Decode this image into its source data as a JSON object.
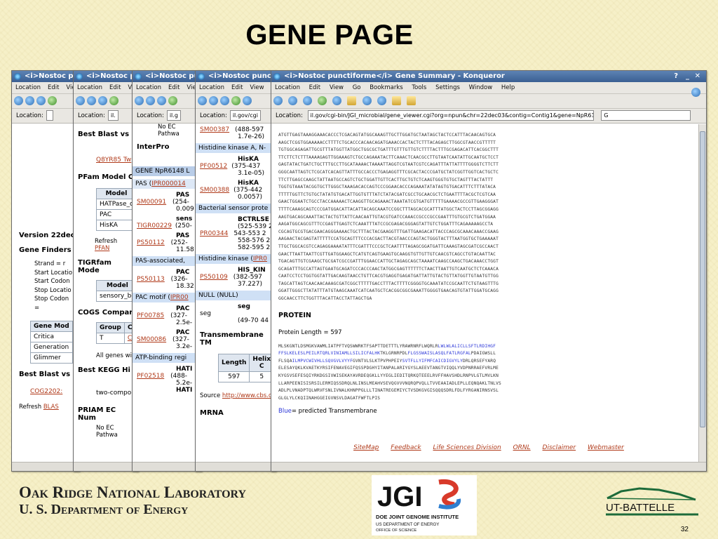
{
  "slide": {
    "title": "GENE PAGE",
    "page_number": "32"
  },
  "window_title_short": "<i>Nostoc pu",
  "menu_short": [
    "Location",
    "Edit",
    "View"
  ],
  "loc_label": "Location:",
  "w1": {
    "title": "<i>Nostoc pur",
    "best_blast_top": "",
    "version": "Version 22dec",
    "gene_finders": "Gene Finders",
    "fields": [
      "Strand = r",
      "Start Locatio",
      "Start Codon",
      "Stop Locatio",
      "Stop Codon ="
    ],
    "table_header": "Gene Mod",
    "rows": [
      "Critica",
      "Generation",
      "Glimmer"
    ],
    "best_blast": "Best Blast vs",
    "cog": "COG2202:",
    "refresh": "Refresh",
    "refresh_link": "BLAS"
  },
  "w2": {
    "title": "<i>Nostoc pun",
    "best_blast": "Best Blast vs",
    "q8": "Q8YR85 Tw",
    "pfam": "PFam Model C",
    "model": "Model",
    "pfam_rows": [
      "HATPase_c",
      "PAC",
      "HisKA"
    ],
    "refresh": "Refresh",
    "refresh_link": "PFAN",
    "tigr": "TIGRfam Mode",
    "tigr_row": "sensory_bo",
    "cogs": "COGS Compar",
    "group": "Group",
    "cc": "CC",
    "t": "T",
    "co": "CO",
    "allgenes": "All genes wi",
    "kegg": "Best KEGG Hi",
    "twocomp": "two-compo",
    "priam": "PRIAM EC Num",
    "noec": "No EC Pathwa"
  },
  "w3": {
    "title": "<i>Nostoc pun",
    "noec": "No EC Pathwa",
    "interpro": "InterPro",
    "gene": "GENE NpR6148 L",
    "pas": "PAS (",
    "pas_link": "IPR000014",
    "items": [
      {
        "id": "PF00092",
        "link": "SM00091",
        "name": "PAS",
        "v1": "(254-",
        "v2": "0.009"
      },
      {
        "id": "",
        "link": "TIGR00229",
        "name": "sens",
        "v1": "(250-",
        "v2": ""
      },
      {
        "id": "",
        "link": "PS50112",
        "name": "PAS",
        "v1": "(252-",
        "v2": "11.58"
      },
      {
        "id": "",
        "link": "PS50113",
        "name": "PAC",
        "v1": "(326-",
        "v2": "18.32"
      },
      {
        "id": "",
        "link": "PF00785",
        "name": "PAC",
        "v1": "(327-",
        "v2": "2.5e-"
      },
      {
        "id": "",
        "link": "SM00086",
        "name": "PAC",
        "v1": "(327-",
        "v2": "3.2e-"
      },
      {
        "id": "",
        "link": "PF02518",
        "name": "HATI",
        "v1": "(488-",
        "v2": "5.2e-"
      }
    ],
    "pas_assoc": "PAS-associated,",
    "pac_motif": "PAC motif (",
    "pac_link": "IPR00",
    "atp": "ATP-binding regi",
    "hat": "HATI"
  },
  "w4": {
    "title": "<i>Nostoc punctifo",
    "loc": "il.gov/cgi",
    "sm387": "SM00387",
    "sm387_v": [
      "(488-597",
      "1.7e-26)"
    ],
    "hk_header": "Histidine kinase A, N-",
    "pf512": "PF00512",
    "pf512_v": [
      "HisKA",
      "(375-437",
      "3.1e-05)"
    ],
    "sm388": "SM00388",
    "sm388_v": [
      "HisKA",
      "(375-442",
      "0.0057)"
    ],
    "bsp": "Bacterial sensor prote",
    "pr344": "PR00344",
    "pr344_v": [
      "BCTRLSE",
      "(525-539 2",
      "543-553 2",
      "558-576 2",
      "582-595 2"
    ],
    "hk2": "Histidine kinase (",
    "hk2_link": "IPR0",
    "ps50109": "PS50109",
    "ps50109_v": [
      "HIS_KIN",
      "(382-597",
      "37.227)"
    ],
    "null": "NULL (NULL)",
    "seg": "seg",
    "seg_v": [
      "seg",
      "(49-70 44"
    ],
    "tm": "Transmembrane TM",
    "tm_cols": [
      "Length",
      "Helix C"
    ],
    "tm_vals": [
      "597",
      "5"
    ],
    "source": "Source ",
    "source_link": "http://www.cbs.d",
    "mrna": "MRNA"
  },
  "main": {
    "title": "<i>Nostoc punctiforme</i> Gene Summary - Konqueror",
    "menu": [
      "Location",
      "Edit",
      "View",
      "Go",
      "Bookmarks",
      "Tools",
      "Settings",
      "Window",
      "Help"
    ],
    "loc_label": "Location:",
    "url": "il.gov/cgi-bin/JGI_microbial/gene_viewer.cgi?org=npun&chr=22dec03&contig=Contig1&gene=NpR6148",
    "search": "G",
    "protein_header": "PROTEIN",
    "protein_length": "Protein Length = 597",
    "legend": "Blue= predicted Transmembrane",
    "links": [
      "SiteMap",
      "Feedback",
      "Life Sciences Division",
      "ORNL",
      "Disclaimer",
      "Webmaster"
    ],
    "dna": [
      "ATGTTGAGTAAAGGAAACACCCTCGACAGTATGGCAAAGTTGCTTGGATGCTAATAGCTACTCCATTTACAACAGTGCA",
      "AAGCTCGGTGGAAAAACCTTTTCTGCACCCACAACAGATGAAACCACTACTCTTTACAGAGCTTGGCGTAACCGTTTTT",
      "TGTGGCAGAGATTGCGTTTATGGTTATGGCTGGCGCTGATTTGTTTGTTGTCTTTTACTTTGCGAGACATTCACGGCTTT",
      "TTCTTCTCTTTAAAAGAGTTGGAAAGTCTGCCAGAAATACTTCAAACTCAACGCCTTGTAATCAATATTGCAATGCTCCT",
      "GAGTATACTGATCTGCTTTGCCTTGCATAAAACTAAAATTAGGTCGTAATCGTCCAGATTTATTATTTTGGGGTCTTCTT",
      "GGGCAATTAGTCTCGCATCACAGTTATTTGCCACCCTGAGAGGTTTCGCACTACCCGATGCTATCGGTTGGTCACTGCTC",
      "TTCTTGAGCCAAGCTATTAATGCCAGTCTGCTGGATTGTTCACTTGCTGTCTCAAGTGGGTGTGCTAGTTTACTATTT",
      "TGGTGTAAATACGGTGCTTGGGCTAAAGACACCAGTCCCGGAACACCCAGAAATATATAGTGTGACATTTCTTTATACA",
      "TTTTTGGTTCTGTGCTATATGTGACATTGGTGTTTATCTATACGATCGCCTGCAACGCTCTGAATTTTACGCTCGTCAA",
      "GAACTGGAATCTGCCTACCAAAAACTCAAGGTTGCAGAAACTAAATATCGTGATGTTTTTGAAAACGCCGTTGAAGGGAT",
      "TTTTCAAAGCAGTCCCGATGGACATTACATTACAGCAAATCCGGCTTTAGCACGCATTTATGGCTACTCCTTAGCGGAGG",
      "AAGTGACAGCAAATTACTACTGTTATTCAACAATTGTACGTGATCCAAACCGCCCGCCGAATTTGTGCGTCTGATGGAA",
      "AAGATGGCAGCGTTTCCGAGTTGAGTCTCAAATTTATCCGCGAGACGGGAGTATTGTCTGGATTTCAGAAAAAGCCTA",
      "CGCAGTGCGTGACGAACAGGGAAAACTGCTTTACTACGAAGGTTTGATTGAAGACATTACCCAGCGCAAACAAACCGAAG",
      "AAGAACTACGAGTATTTTTCCATGCAGTTTCCCACGACTTACGTAACCCAGTACTGGGTACTTTAATGGTGCTGAAAAAT",
      "TTGCTGGCACGTCCAGAGGAAAATATTTCGATTTCCCGCTCAATTTTAGAGCGGATGATTCAAAGTAGCGATCGCCAACT",
      "GAACTTAATTAATTCGTTGATGGAAGCTCATGTCAGTGAAGTGCAAGGTGTTGTTGTCAACGTCAGCCTGTACAATTAC",
      "TGACAGTTGTCGAAGCTGCGATCGCCGATTTGGAACCATTGCTAGAGCAGCTAAAATCAAGCCAAGCTGACAAACCTGGT",
      "GCAGATTTGCCATTAGTGAATGCAGATCCCACCCAACTATGGCGAGTTTTTTCTAACTTAATTGTCAATGCTCTCAAACA",
      "CAATCCTCCTGGTGGTATTGACAAGTAACCTGTTCACGTGAGGTGAGATGATTATTGTACTGTTATGGTTGTAATGTTGG",
      "TAGCATTAGTCAACAACAAAGCGATCGGCTTTTTGACCTTTACTTTTCGGGGTGCAAATATCCGCAATTCTGTAAGTTTG",
      "GGATTGGGCTTATATTTATGTAAGCAAATCATCAATGCTCACGGCGGCGAAATTGGGGTGAACAGTGTATTGGATGCAGG",
      "GGCAACCTTCTGGTTTACATTACCTATTAGCTGA"
    ],
    "protein": [
      {
        "seg": [
          {
            "t": "MLSKGNTLDSMGKVAWMLIATPFTVQSWWRKTFSAPTTDETTTLYRAWRNRFLWQRLR",
            "b": false
          },
          {
            "t": "LWLWLALICLLSFTLRDIHGF",
            "b": true
          }
        ]
      },
      {
        "seg": [
          {
            "t": "FFSLKELESLPEILRTQR",
            "b": true
          },
          {
            "t": "LVINIAMLLSILICFALHK",
            "b": true
          },
          {
            "t": "TKLGRNRPDL",
            "b": false
          },
          {
            "t": "FLGSSWAISLASQLFATLRGFAL",
            "b": true
          },
          {
            "t": "PDAIGWSLL",
            "b": false
          }
        ]
      },
      {
        "seg": [
          {
            "t": "FLSQA",
            "b": false
          },
          {
            "t": "ILMPVCWIVHLLSQVGVLVYYF",
            "b": true
          },
          {
            "t": "GVNTVLSLKTPVPHPEIY",
            "b": false
          },
          {
            "t": "SVTFLLYIFMFCAICDIGVYLY",
            "b": true
          },
          {
            "t": "DRLQRSEFYARQ",
            "b": false
          }
        ]
      },
      {
        "seg": [
          {
            "t": "ELESAYQKLKVAETKYRSIFENAVEGIFQSSPDGHYITANPALARIYGYSLAEEVTANGTVIQQLYVDPNRRAEFVRLME",
            "b": false
          }
        ]
      },
      {
        "seg": [
          {
            "t": "KYGSVSEFESQIYRKDGSIVWISEKAYAVRDEQGKLLYYEGLIEDITQRKQTEEELRVFFHAVSHDLRNPVLGTLMVLKN",
            "b": false
          }
        ]
      },
      {
        "seg": [
          {
            "t": "LLARPEENISISRSILERMIQSSDRQLNLINSLMEAHVSEVQGVVVNQRQPVQLLTVVEAAIADLEPLLEQNQAKLTNLVS",
            "b": false
          }
        ]
      },
      {
        "seg": [
          {
            "t": "ADLPLVNADPTQLWRVFSNLIVNALKHNPPGLLLTINATREGEMIYCTVSDKGVGISQQQSDRLFDLFYRGANIRNSVSL",
            "b": false
          }
        ]
      },
      {
        "seg": [
          {
            "t": "GLGLYLCKQIINAHGGEIGVNSVLDAGATFWFTLPIS",
            "b": false
          }
        ]
      }
    ]
  },
  "footer": {
    "ornl_line1": "Oak Ridge National Laboratory",
    "ornl_line2": "U. S. Department of Energy",
    "jgi_text": "JGI",
    "jgi_line1": "DOE JOINT GENOME INSTITUTE",
    "jgi_line2": "US DEPARTMENT OF ENERGY",
    "jgi_line3": "OFFICE OF SCIENCE",
    "utb": "UT-BATTELLE"
  },
  "colors": {
    "link": "#b03a1a",
    "transmembrane": "#2a35d8",
    "titlebar": "#3a5f92",
    "highlight": "#cfe0f5"
  }
}
